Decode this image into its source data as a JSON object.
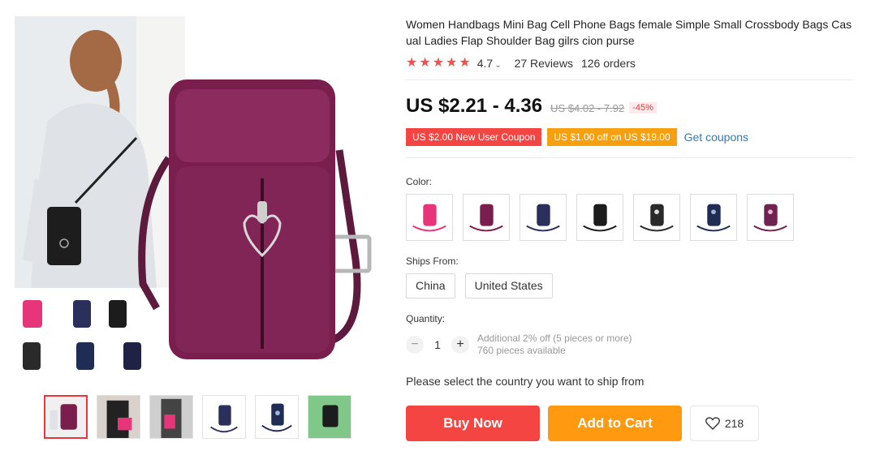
{
  "product": {
    "title": "Women Handbags Mini Bag Cell Phone Bags female Simple Small Crossbody Bags Casual Ladies Flap Shoulder Bag gilrs cion purse",
    "rating": "4.7",
    "reviews": "27 Reviews",
    "orders": "126 orders",
    "price": "US $2.21 - 4.36",
    "original_price": "US $4.02 - 7.92",
    "discount": "-45%"
  },
  "coupons": {
    "new_user": "US $2.00 New User Coupon",
    "store": "US $1.00 off on US $19.00",
    "get_coupons": "Get coupons"
  },
  "color": {
    "label": "Color:",
    "options": [
      {
        "icon": "pink-bag-icon",
        "color": "#e8357a"
      },
      {
        "icon": "purple-bag-icon",
        "color": "#7a1f4d"
      },
      {
        "icon": "navy-bag-icon",
        "color": "#2b2f5c"
      },
      {
        "icon": "black-bag-icon",
        "color": "#1c1c1c"
      },
      {
        "icon": "black-floral-bag-icon",
        "color": "#2a2a2a"
      },
      {
        "icon": "navy-floral-bag-icon",
        "color": "#1f2d55"
      },
      {
        "icon": "purple-floral-bag-icon",
        "color": "#6e2350"
      }
    ]
  },
  "shipping": {
    "label": "Ships From:",
    "options": [
      "China",
      "United States"
    ],
    "message": "Please select the country you want to ship from"
  },
  "quantity": {
    "label": "Quantity:",
    "value": "1",
    "minus": "−",
    "plus": "+",
    "note_line1": "Additional 2% off (5 pieces or more)",
    "note_line2": "760 pieces available"
  },
  "actions": {
    "buy_now": "Buy Now",
    "add_to_cart": "Add to Cart",
    "wishlist_count": "218"
  },
  "colors": {
    "accent_red": "#f44542",
    "accent_orange": "#ff9a10",
    "link_blue": "#2e7ab8",
    "bag_purple": "#7a1f4d"
  }
}
